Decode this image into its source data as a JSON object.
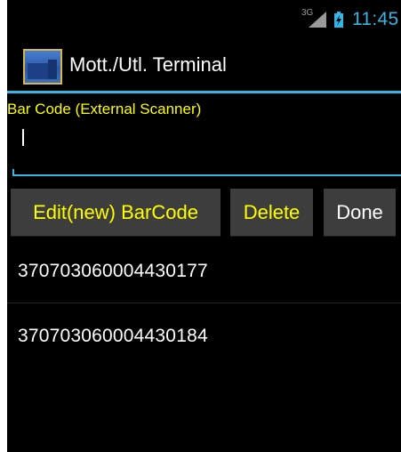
{
  "status_bar": {
    "network_label": "3G",
    "time": "11:45",
    "accent_color": "#33b5e5",
    "icons": [
      "signal-icon",
      "battery-charging-icon"
    ]
  },
  "action_bar": {
    "title": "Mott./Utl. Terminal",
    "icon": "app-truck-icon"
  },
  "scanner": {
    "label": "Bar Code (External Scanner)",
    "value": ""
  },
  "buttons": {
    "edit": "Edit(new) BarCode",
    "delete": "Delete",
    "done": "Done"
  },
  "barcodes": [
    "370703060004430177",
    "370703060004430184"
  ],
  "colors": {
    "accent": "#33b5e5",
    "label_text": "#ffff00",
    "background": "#000000",
    "button_bg": "#3d3d3d"
  }
}
